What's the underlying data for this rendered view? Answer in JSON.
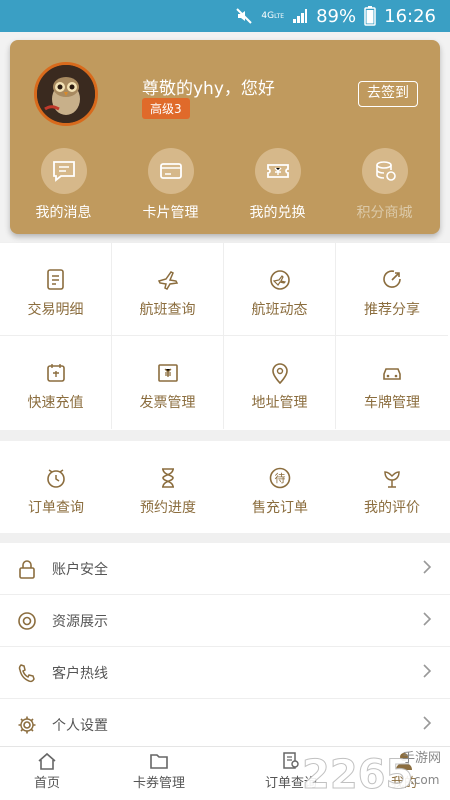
{
  "status_bar": {
    "network": "4G",
    "network_sub": "LTE",
    "battery": "89%",
    "time": "16:26"
  },
  "profile": {
    "greeting": "尊敬的yhy，您好",
    "level": "高级3",
    "signin_label": "去签到"
  },
  "quick_actions": [
    {
      "label": "我的消息",
      "icon": "message-icon"
    },
    {
      "label": "卡片管理",
      "icon": "card-icon"
    },
    {
      "label": "我的兑换",
      "icon": "ticket-icon"
    },
    {
      "label": "积分商城",
      "icon": "coins-icon"
    }
  ],
  "services": [
    {
      "label": "交易明细",
      "icon": "receipt-icon"
    },
    {
      "label": "航班查询",
      "icon": "plane-icon"
    },
    {
      "label": "航班动态",
      "icon": "flight-status-icon"
    },
    {
      "label": "推荐分享",
      "icon": "share-icon"
    },
    {
      "label": "快速充值",
      "icon": "recharge-icon"
    },
    {
      "label": "发票管理",
      "icon": "invoice-icon"
    },
    {
      "label": "地址管理",
      "icon": "location-icon"
    },
    {
      "label": "车牌管理",
      "icon": "car-icon"
    }
  ],
  "orders": [
    {
      "label": "订单查询",
      "icon": "clock-icon"
    },
    {
      "label": "预约进度",
      "icon": "hourglass-icon"
    },
    {
      "label": "售充订单",
      "icon": "pending-icon"
    },
    {
      "label": "我的评价",
      "icon": "flower-icon"
    }
  ],
  "settings": [
    {
      "label": "账户安全",
      "icon": "lock-icon"
    },
    {
      "label": "资源展示",
      "icon": "target-icon"
    },
    {
      "label": "客户热线",
      "icon": "phone-icon"
    },
    {
      "label": "个人设置",
      "icon": "gear-icon"
    }
  ],
  "tabs": [
    {
      "label": "首页",
      "icon": "home-icon"
    },
    {
      "label": "卡券管理",
      "icon": "folder-icon"
    },
    {
      "label": "订单查询",
      "icon": "order-search-icon"
    },
    {
      "label": "我的",
      "icon": "user-icon"
    }
  ],
  "watermark": {
    "text": "2265",
    "sub": "手游网",
    "domain": ".com"
  },
  "colors": {
    "status_bar": "#3a9fc4",
    "card": "#c09a5e",
    "accent": "#8b6d3e",
    "badge": "#e06a2a"
  }
}
